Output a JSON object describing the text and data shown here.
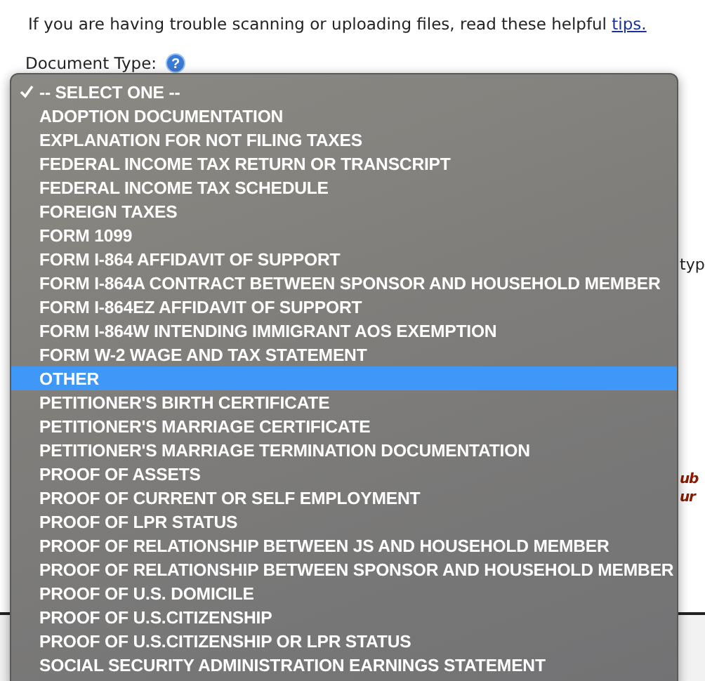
{
  "intro": {
    "text": "If you are having trouble scanning or uploading files, read these helpful ",
    "link": "tips."
  },
  "document_type": {
    "label": "Document Type:",
    "help": "?"
  },
  "side_fragments": [
    {
      "text": "typ",
      "kind": "plain"
    },
    {
      "text": "ub",
      "kind": "warning"
    },
    {
      "text": "ur",
      "kind": "warning"
    }
  ],
  "dropdown": {
    "options": [
      {
        "label": "-- SELECT ONE --",
        "checked": true,
        "highlighted": false
      },
      {
        "label": "ADOPTION DOCUMENTATION",
        "checked": false,
        "highlighted": false
      },
      {
        "label": "EXPLANATION FOR NOT FILING TAXES",
        "checked": false,
        "highlighted": false
      },
      {
        "label": "FEDERAL INCOME TAX RETURN OR TRANSCRIPT",
        "checked": false,
        "highlighted": false
      },
      {
        "label": "FEDERAL INCOME TAX SCHEDULE",
        "checked": false,
        "highlighted": false
      },
      {
        "label": "FOREIGN TAXES",
        "checked": false,
        "highlighted": false
      },
      {
        "label": "FORM 1099",
        "checked": false,
        "highlighted": false
      },
      {
        "label": "FORM I-864 AFFIDAVIT OF SUPPORT",
        "checked": false,
        "highlighted": false
      },
      {
        "label": "FORM I-864A CONTRACT BETWEEN SPONSOR AND HOUSEHOLD MEMBER",
        "checked": false,
        "highlighted": false
      },
      {
        "label": "FORM I-864EZ AFFIDAVIT OF SUPPORT",
        "checked": false,
        "highlighted": false
      },
      {
        "label": "FORM I-864W INTENDING IMMIGRANT AOS EXEMPTION",
        "checked": false,
        "highlighted": false
      },
      {
        "label": "FORM W-2 WAGE AND TAX STATEMENT",
        "checked": false,
        "highlighted": false
      },
      {
        "label": "OTHER",
        "checked": false,
        "highlighted": true
      },
      {
        "label": "PETITIONER'S BIRTH CERTIFICATE",
        "checked": false,
        "highlighted": false
      },
      {
        "label": "PETITIONER'S MARRIAGE CERTIFICATE",
        "checked": false,
        "highlighted": false
      },
      {
        "label": "PETITIONER'S MARRIAGE TERMINATION DOCUMENTATION",
        "checked": false,
        "highlighted": false
      },
      {
        "label": "PROOF OF ASSETS",
        "checked": false,
        "highlighted": false
      },
      {
        "label": "PROOF OF CURRENT OR SELF EMPLOYMENT",
        "checked": false,
        "highlighted": false
      },
      {
        "label": "PROOF OF LPR STATUS",
        "checked": false,
        "highlighted": false
      },
      {
        "label": "PROOF OF RELATIONSHIP BETWEEN JS AND HOUSEHOLD MEMBER",
        "checked": false,
        "highlighted": false
      },
      {
        "label": "PROOF OF RELATIONSHIP BETWEEN SPONSOR AND HOUSEHOLD MEMBER",
        "checked": false,
        "highlighted": false
      },
      {
        "label": "PROOF OF U.S. DOMICILE",
        "checked": false,
        "highlighted": false
      },
      {
        "label": "PROOF OF U.S.CITIZENSHIP",
        "checked": false,
        "highlighted": false
      },
      {
        "label": "PROOF OF U.S.CITIZENSHIP OR LPR STATUS",
        "checked": false,
        "highlighted": false
      },
      {
        "label": "SOCIAL SECURITY ADMINISTRATION EARNINGS STATEMENT",
        "checked": false,
        "highlighted": false
      }
    ]
  }
}
